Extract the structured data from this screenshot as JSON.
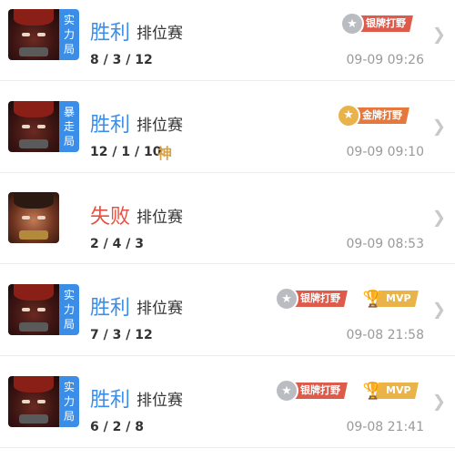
{
  "matches": [
    {
      "avatar": "hero-a",
      "tag": [
        "实",
        "力",
        "局"
      ],
      "result": "胜利",
      "result_type": "win",
      "mode": "排位赛",
      "kda": "8 / 3 / 12",
      "time": "09-09 09:26",
      "badges": [
        {
          "kind": "silver",
          "label": "银牌打野"
        }
      ]
    },
    {
      "avatar": "hero-a",
      "tag": [
        "暴",
        "走",
        "局"
      ],
      "result": "胜利",
      "result_type": "win",
      "mode": "排位赛",
      "kda": "12 / 1 / 10",
      "extra": "神",
      "time": "09-09 09:10",
      "badges": [
        {
          "kind": "gold",
          "label": "金牌打野"
        }
      ]
    },
    {
      "avatar": "hero-b",
      "tag": [],
      "result": "失败",
      "result_type": "lose",
      "mode": "排位赛",
      "kda": "2 / 4 / 3",
      "time": "09-09 08:53",
      "badges": []
    },
    {
      "avatar": "hero-a",
      "tag": [
        "实",
        "力",
        "局"
      ],
      "result": "胜利",
      "result_type": "win",
      "mode": "排位赛",
      "kda": "7 / 3 / 12",
      "time": "09-08 21:58",
      "badges": [
        {
          "kind": "silver",
          "label": "银牌打野"
        },
        {
          "kind": "mvp",
          "label": "MVP"
        }
      ]
    },
    {
      "avatar": "hero-a",
      "tag": [
        "实",
        "力",
        "局"
      ],
      "result": "胜利",
      "result_type": "win",
      "mode": "排位赛",
      "kda": "6 / 2 / 8",
      "time": "09-08 21:41",
      "badges": [
        {
          "kind": "silver",
          "label": "银牌打野"
        },
        {
          "kind": "mvp",
          "label": "MVP"
        }
      ]
    }
  ],
  "colors": {
    "win": "#3a8ee8",
    "lose": "#e8503f",
    "tag_bg": "#3a8ee8",
    "time": "#9a9a9a"
  },
  "icons": {
    "chevron": "chevron-right-icon",
    "medal": "medal-icon",
    "trophy": "trophy-icon"
  }
}
